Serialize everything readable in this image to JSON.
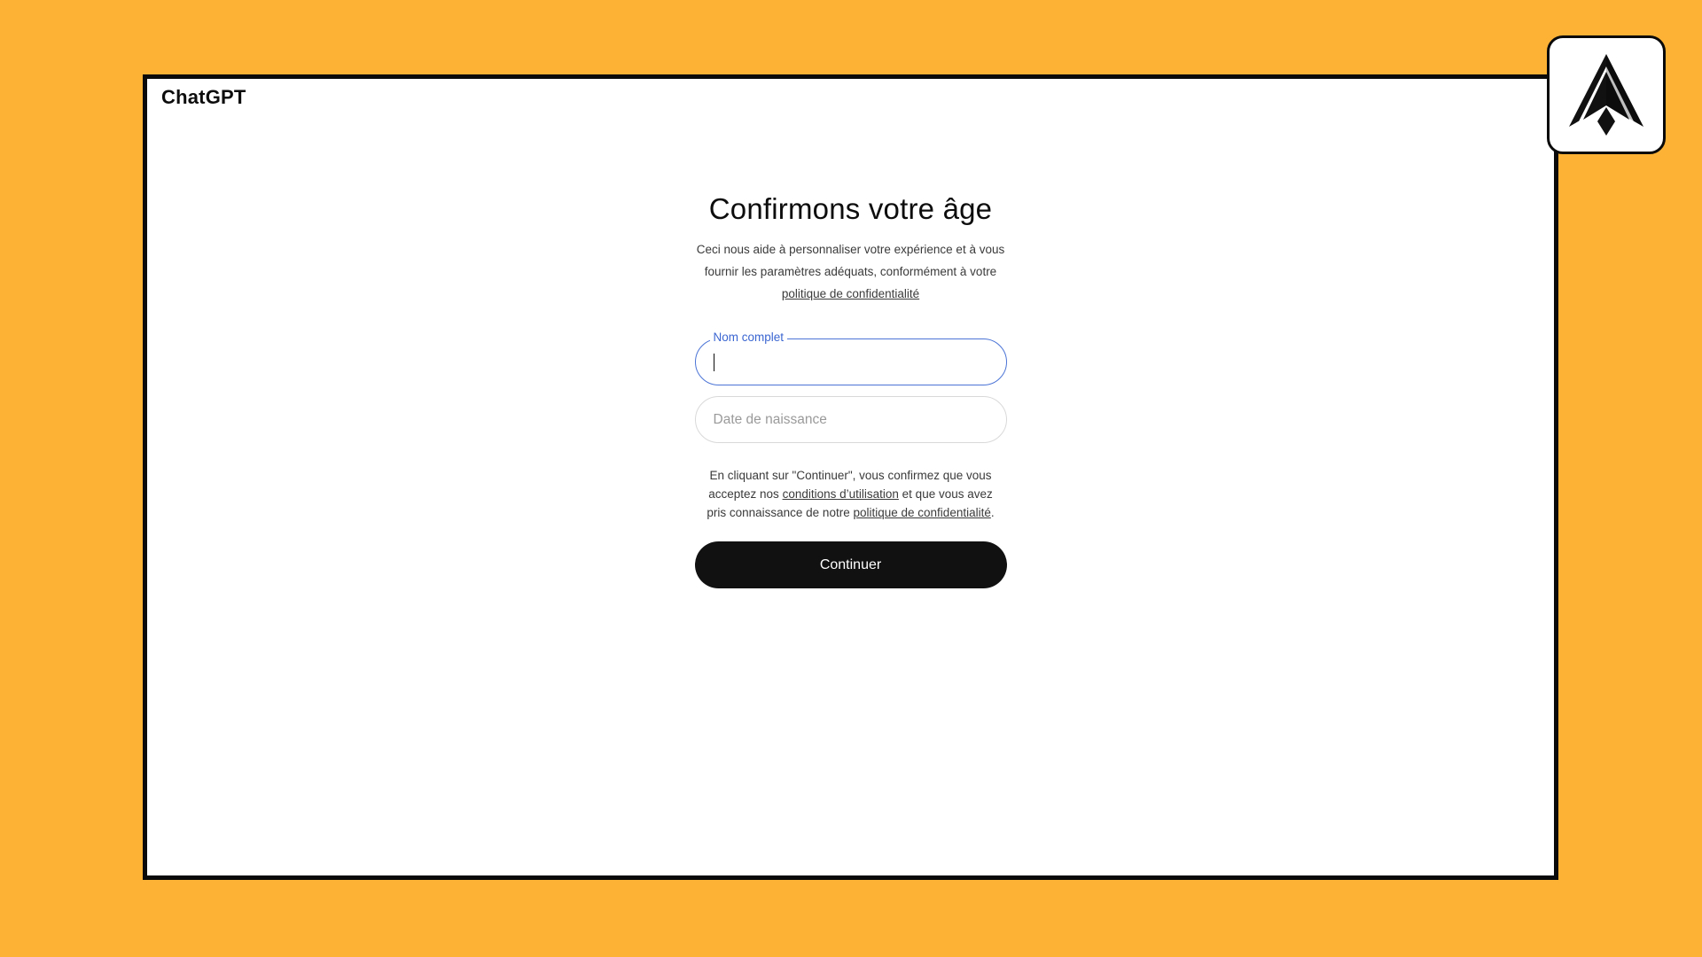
{
  "app": {
    "brand": "ChatGPT"
  },
  "form": {
    "title": "Confirmons votre âge",
    "subtitle_text": "Ceci nous aide à personnaliser votre expérience et à vous fournir les paramètres adéquats, conformément à votre",
    "subtitle_link": "politique de confidentialité",
    "name_field": {
      "label": "Nom complet",
      "value": ""
    },
    "birthdate_field": {
      "placeholder": "Date de naissance",
      "value": ""
    },
    "terms": {
      "part1": "En cliquant sur \"Continuer\", vous confirmez que vous acceptez nos",
      "link1": "conditions d’utilisation",
      "part2": "et que vous avez pris connaissance de notre",
      "link2": "politique de confidentialité",
      "part3": "."
    },
    "continue_label": "Continuer"
  },
  "icons": {
    "corner_logo": "stylized-a-logo-icon"
  },
  "colors": {
    "background": "#FDB236",
    "focus_border": "#4b74d6",
    "focus_label": "#3b66d1",
    "button": "#111111"
  }
}
